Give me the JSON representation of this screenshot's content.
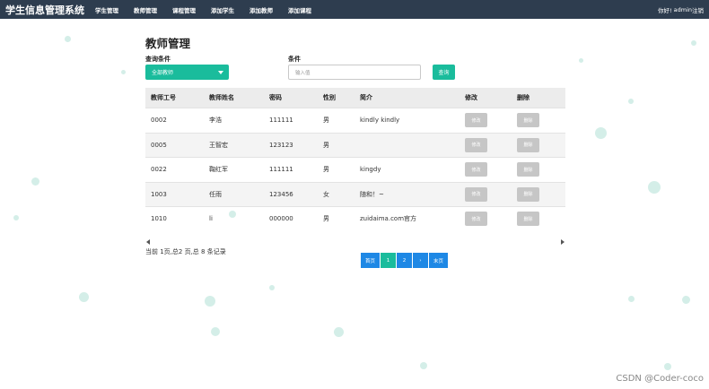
{
  "navbar": {
    "brand": "学生信息管理系统",
    "items": [
      "学生管理",
      "教师管理",
      "课程管理",
      "添加学生",
      "添加教师",
      "添加课程"
    ],
    "greeting": "你好!",
    "user": "admin",
    "logout": "注销"
  },
  "page": {
    "title": "教师管理"
  },
  "filter": {
    "condition_label": "查询条件",
    "select_value": "全部教师",
    "keyword_label": "条件",
    "input_placeholder": "输入值",
    "query_button": "查询"
  },
  "table": {
    "headers": [
      "教师工号",
      "教师姓名",
      "密码",
      "性别",
      "简介",
      "修改",
      "删除"
    ],
    "rows": [
      {
        "id": "0002",
        "name": "李浩",
        "password": "111111",
        "gender": "男",
        "intro": "kindly kindly",
        "edit": "修改",
        "delete": "删除"
      },
      {
        "id": "0005",
        "name": "王智宏",
        "password": "123123",
        "gender": "男",
        "intro": "",
        "edit": "修改",
        "delete": "删除"
      },
      {
        "id": "0022",
        "name": "鞠红军",
        "password": "111111",
        "gender": "男",
        "intro": "kingdy",
        "edit": "修改",
        "delete": "删除"
      },
      {
        "id": "1003",
        "name": "任雨",
        "password": "123456",
        "gender": "女",
        "intro": "随和！~",
        "edit": "修改",
        "delete": "删除"
      },
      {
        "id": "1010",
        "name": "li",
        "password": "000000",
        "gender": "男",
        "intro": "zuidaima.com官方",
        "edit": "修改",
        "delete": "删除"
      }
    ]
  },
  "pagination": {
    "summary": "当前 1页,总2 页,总 8 条记录",
    "first": "首页",
    "pages": [
      "1",
      "2"
    ],
    "next": "›",
    "last": "末页"
  },
  "watermark": "CSDN @Coder-coco",
  "colors": {
    "navbar": "#2e3d4f",
    "accent": "#1abc9c",
    "pager": "#1e88e5"
  }
}
